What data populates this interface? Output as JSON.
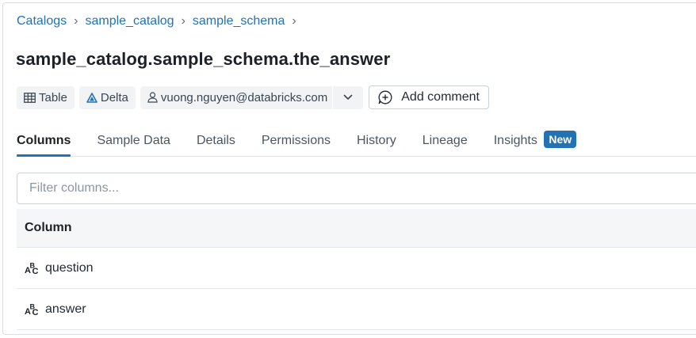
{
  "breadcrumb": {
    "items": [
      "Catalogs",
      "sample_catalog",
      "sample_schema"
    ],
    "separator": "›"
  },
  "title": "sample_catalog.sample_schema.the_answer",
  "tags": {
    "type_label": "Table",
    "format_label": "Delta",
    "owner_label": "vuong.nguyen@databricks.com"
  },
  "add_comment_label": "Add comment",
  "tabs": [
    {
      "label": "Columns",
      "active": true
    },
    {
      "label": "Sample Data"
    },
    {
      "label": "Details"
    },
    {
      "label": "Permissions"
    },
    {
      "label": "History"
    },
    {
      "label": "Lineage"
    },
    {
      "label": "Insights",
      "badge": "New"
    }
  ],
  "filter": {
    "placeholder": "Filter columns..."
  },
  "columns_table": {
    "header": "Column",
    "rows": [
      {
        "name": "question",
        "type_icon": "string-type-icon"
      },
      {
        "name": "answer",
        "type_icon": "string-type-icon"
      }
    ]
  },
  "colors": {
    "accent": "#2272b4",
    "tag_bg": "#f1f3f5"
  }
}
